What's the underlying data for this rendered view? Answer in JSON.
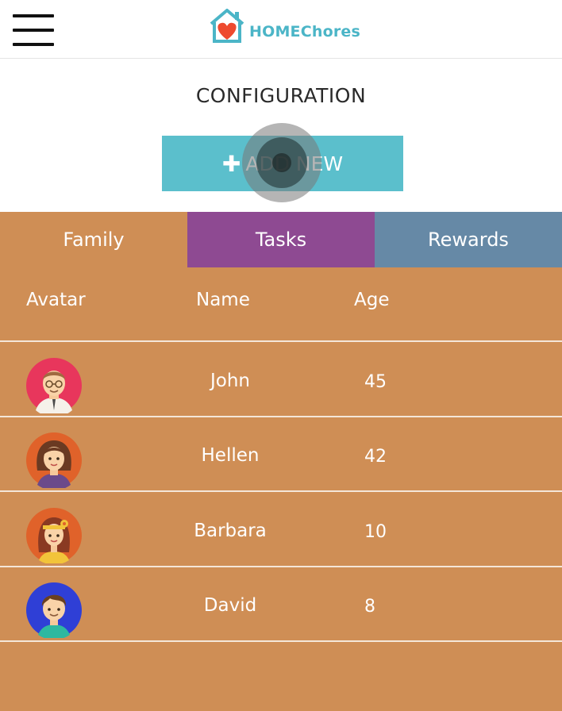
{
  "header": {
    "logo_text": "HOMEChores",
    "menu_icon": "hamburger-menu-icon",
    "logo_icon": "house-heart-icon"
  },
  "config": {
    "title": "CONFIGURATION",
    "add_button_label": "ADD NEW",
    "add_button_icon": "plus-icon"
  },
  "tabs": [
    {
      "label": "Family",
      "color": "#cf8e55"
    },
    {
      "label": "Tasks",
      "color": "#8e4a92"
    },
    {
      "label": "Rewards",
      "color": "#6689a6"
    }
  ],
  "table": {
    "columns": [
      "Avatar",
      "Name",
      "Age"
    ],
    "rows": [
      {
        "name": "John",
        "age": "45",
        "avatar": "man-glasses-avatar-icon",
        "avatar_bg": "#e8365c"
      },
      {
        "name": "Hellen",
        "age": "42",
        "avatar": "woman-avatar-icon",
        "avatar_bg": "#e0622a"
      },
      {
        "name": "Barbara",
        "age": "10",
        "avatar": "girl-flower-avatar-icon",
        "avatar_bg": "#e0622a"
      },
      {
        "name": "David",
        "age": "8",
        "avatar": "boy-avatar-icon",
        "avatar_bg": "#2f3fd6"
      }
    ]
  },
  "colors": {
    "accent": "#5bbfcc",
    "panel": "#cf8e55"
  }
}
